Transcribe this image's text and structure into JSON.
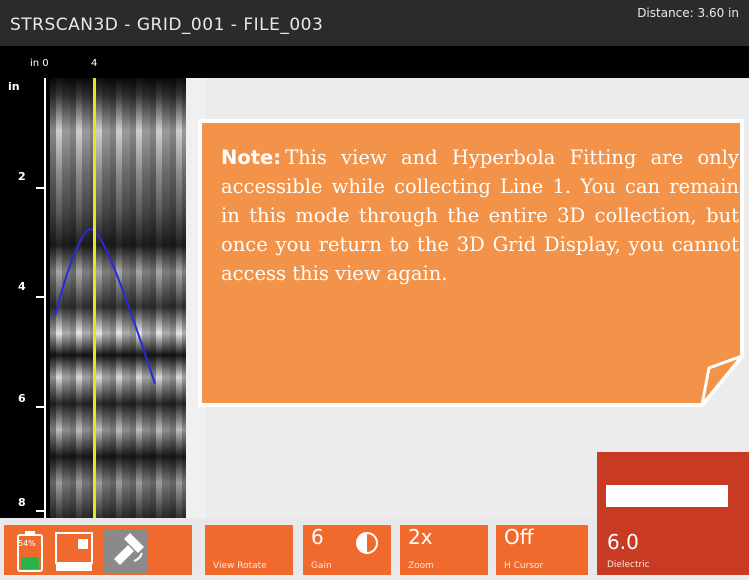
{
  "title": "STRSCAN3D - GRID_001 - FILE_003",
  "distance": "Distance: 3.60 in",
  "top_axis": {
    "a": "in 0",
    "b": "4"
  },
  "left_axis": {
    "unit": "in",
    "labels": [
      "2",
      "4",
      "6",
      "8"
    ]
  },
  "note": {
    "label": "Note:",
    "text": "This view and Hyperbola Fitting are only accessible while collecting Line 1. You can remain in this mode through the entire 3D collection, but once you return to the 3D Grid Display, you cannot access this view again."
  },
  "status": {
    "battery": "54%"
  },
  "toolbar": {
    "view_rotate": "View Rotate",
    "gain": {
      "value": "6",
      "label": "Gain"
    },
    "zoom": {
      "value": "2x",
      "label": "Zoom"
    },
    "hcursor": {
      "value": "Off",
      "label": "H Cursor"
    },
    "dielectric": {
      "value": "6.0",
      "label": "Dielectric"
    }
  },
  "colors": {
    "accent": "#f06a2e",
    "note_bg": "#f39249",
    "dielectric_panel": "#c93a22",
    "cursor": "#e6e61a"
  },
  "icons": [
    "battery-icon",
    "scan-icon",
    "satellite-icon",
    "contrast-icon"
  ]
}
